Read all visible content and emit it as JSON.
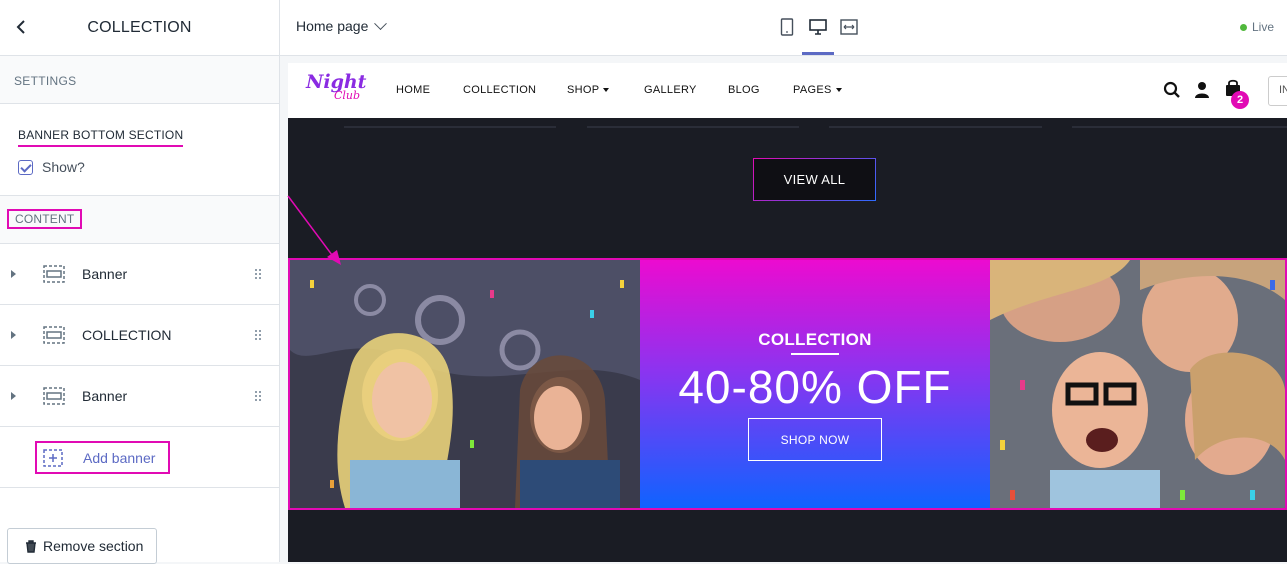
{
  "sidebar": {
    "title": "COLLECTION",
    "settings_label": "SETTINGS",
    "section_heading": "BANNER BOTTOM SECTION",
    "show_label": "Show?",
    "show_checked": true,
    "content_label": "CONTENT",
    "items": [
      {
        "label": "Banner"
      },
      {
        "label": "COLLECTION"
      },
      {
        "label": "Banner"
      }
    ],
    "add_label": "Add banner",
    "remove_label": "Remove section"
  },
  "topbar": {
    "page_selected": "Home page",
    "live_label": "Live",
    "active_device": "desktop"
  },
  "preview": {
    "logo_line1": "Night",
    "logo_line2": "Club",
    "nav": [
      {
        "label": "HOME",
        "dropdown": false
      },
      {
        "label": "COLLECTION",
        "dropdown": false
      },
      {
        "label": "SHOP",
        "dropdown": true
      },
      {
        "label": "GALLERY",
        "dropdown": false
      },
      {
        "label": "BLOG",
        "dropdown": false
      },
      {
        "label": "PAGES",
        "dropdown": true
      }
    ],
    "cart_count": "2",
    "search_stub": "IN",
    "view_all": "VIEW ALL",
    "banner": {
      "subtitle": "COLLECTION",
      "title": "40-80% OFF",
      "button": "SHOP NOW"
    }
  },
  "colors": {
    "accent_annotation": "#e10ab4",
    "editor_accent": "#5c6ac4",
    "live": "#50b83c",
    "banner_gradient_top": "#ec0bd0",
    "banner_gradient_bottom": "#0f63ff",
    "preview_bg": "#1a1c24"
  }
}
